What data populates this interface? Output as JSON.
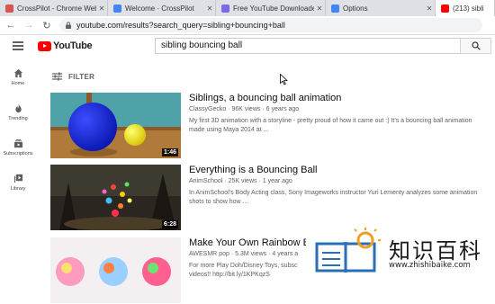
{
  "browser": {
    "tabs": [
      {
        "title": "CrossPilot - Chrome Web S",
        "favicon_color": "#d9534f",
        "active": false
      },
      {
        "title": "Welcome · CrossPilot",
        "favicon_color": "#4285f4",
        "active": false
      },
      {
        "title": "Free YouTube Downloader",
        "favicon_color": "#7b68ee",
        "active": false
      },
      {
        "title": "Options",
        "favicon_color": "#4285f4",
        "active": false
      },
      {
        "title": "(213) sibli",
        "favicon_color": "#ff0000",
        "active": true
      }
    ],
    "url": "youtube.com/results?search_query=sibling+bouncing+ball"
  },
  "youtube": {
    "logo_text": "YouTube",
    "search_value": "sibling bouncing ball",
    "sidebar": [
      {
        "label": "Home",
        "icon": "home-icon"
      },
      {
        "label": "Trending",
        "icon": "fire-icon"
      },
      {
        "label": "Subscriptions",
        "icon": "subscriptions-icon"
      },
      {
        "label": "Library",
        "icon": "library-icon"
      }
    ],
    "filter_label": "FILTER",
    "results": [
      {
        "title": "Siblings, a bouncing ball animation",
        "channel": "ClassyGecko",
        "views": "96K views",
        "age": "6 years ago",
        "desc_line1": "My first 3D animation with a storyline - pretty proud of how it came out :) It's a bouncing ball animation",
        "desc_line2": "made using Maya 2014 at ...",
        "duration": "1:46"
      },
      {
        "title": "Everything is a Bouncing Ball",
        "channel": "AnimSchool",
        "views": "25K views",
        "age": "1 year ago",
        "desc_line1": "In AnimSchool's Body Acting class, Sony Imageworks instructor Yuri Lementy analyzes some animation",
        "desc_line2": "shots to show how ...",
        "duration": "6:28"
      },
      {
        "title": "Make Your Own Rainbow Bo",
        "channel": "AWESMR pop",
        "views": "5.3M views",
        "age": "4 years a",
        "desc_line1": "For more Play Doh/Disney Toys, subsc",
        "desc_line2": "videos!! http://bit.ly/1KPKqzS",
        "duration": ""
      }
    ]
  },
  "watermark": {
    "chinese": "知识百科",
    "url": "www.zhishibaike.com"
  }
}
